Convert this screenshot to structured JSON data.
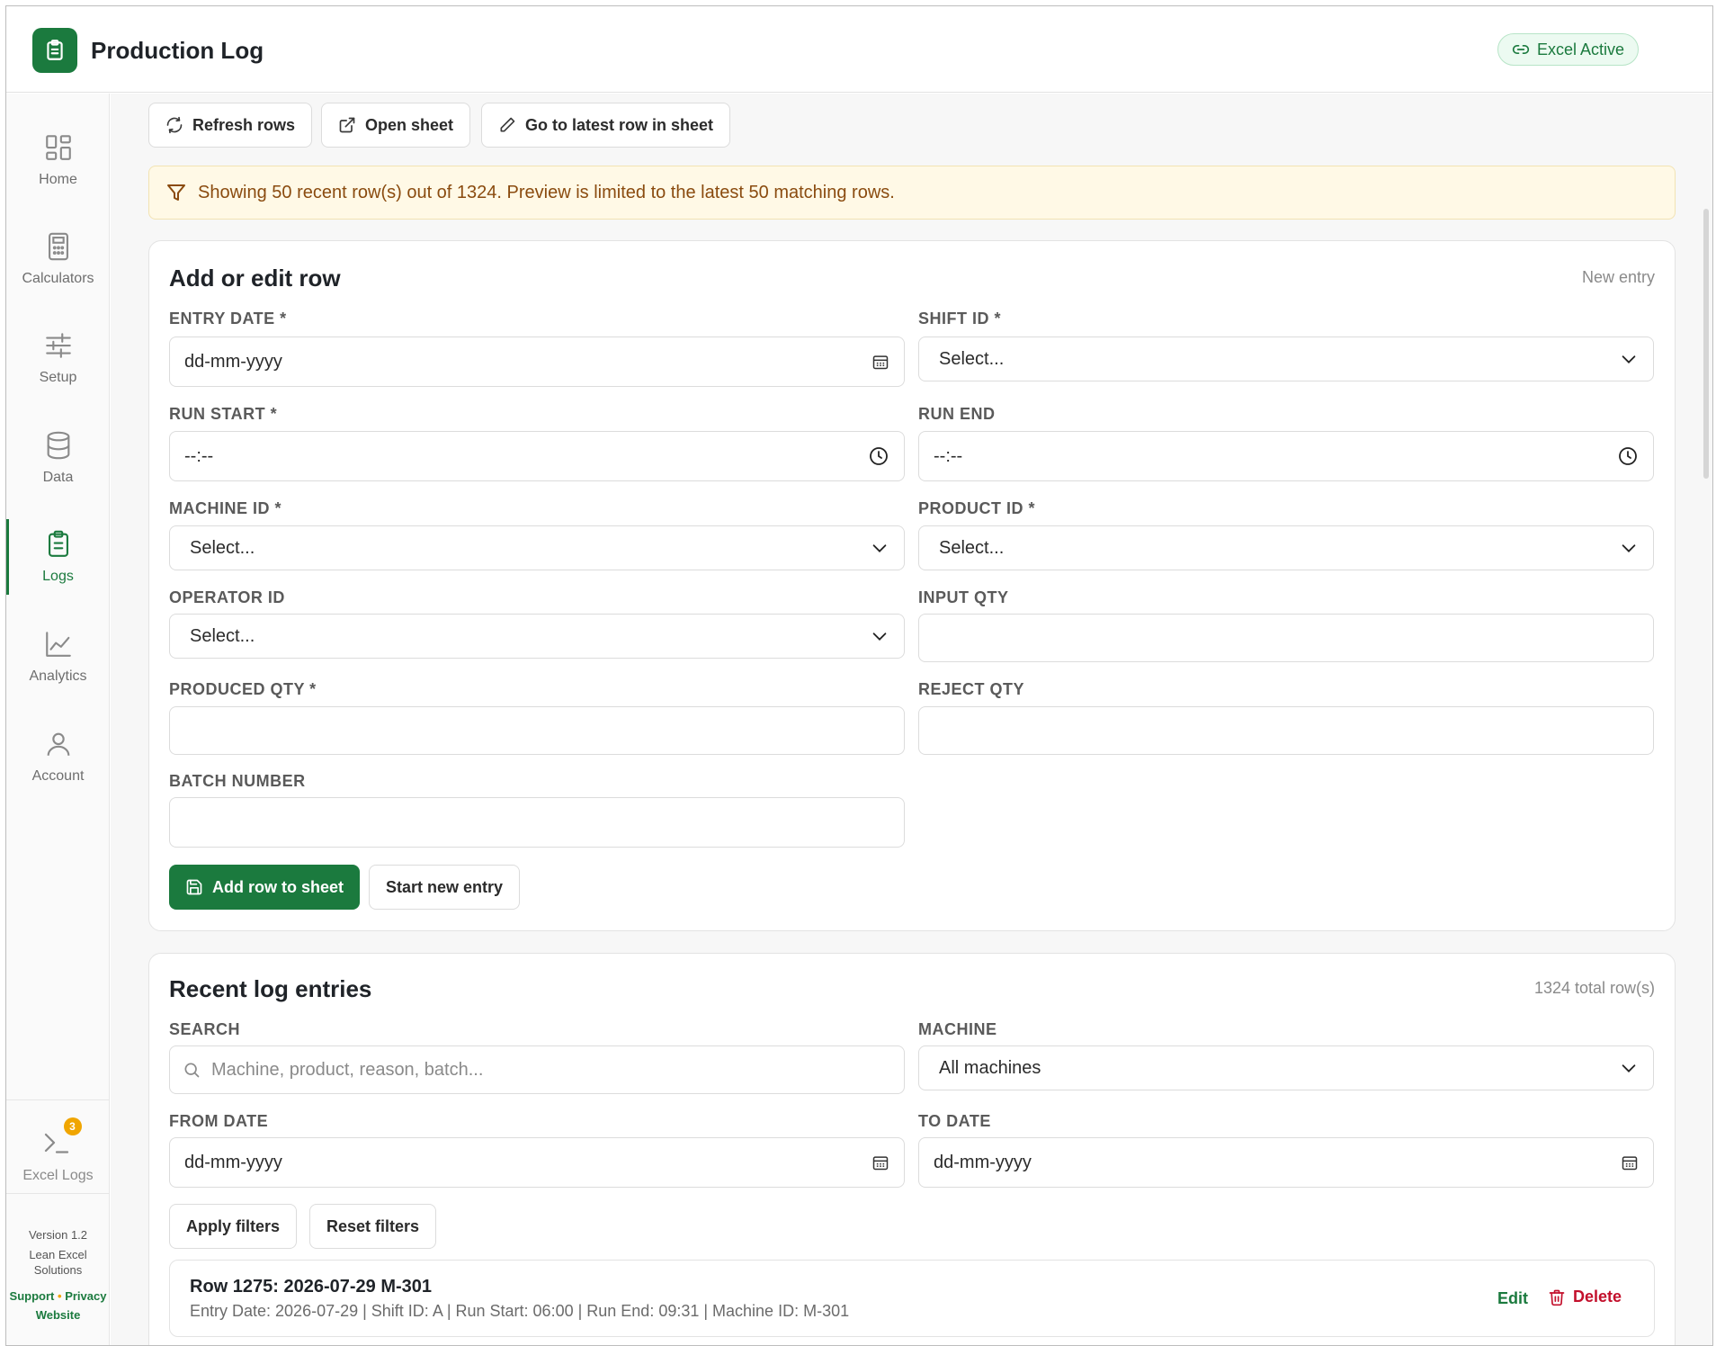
{
  "header": {
    "title": "Production Log",
    "status_badge": "Excel Active"
  },
  "sidebar": {
    "items": [
      {
        "label": "Home",
        "icon": "dashboard-icon"
      },
      {
        "label": "Calculators",
        "icon": "calculator-icon"
      },
      {
        "label": "Setup",
        "icon": "sliders-icon"
      },
      {
        "label": "Data",
        "icon": "database-icon"
      },
      {
        "label": "Logs",
        "icon": "clipboard-icon",
        "active": true
      },
      {
        "label": "Analytics",
        "icon": "chart-line-icon"
      },
      {
        "label": "Account",
        "icon": "user-icon"
      }
    ],
    "excel_logs": {
      "label": "Excel Logs",
      "count": "3"
    },
    "footer": {
      "version": "Version 1.2",
      "company": "Lean Excel Solutions",
      "support": "Support",
      "separator": "•",
      "privacy": "Privacy",
      "website": "Website"
    }
  },
  "toolbar": {
    "refresh": "Refresh rows",
    "open_sheet": "Open sheet",
    "go_latest": "Go to latest row in sheet"
  },
  "notice": "Showing 50 recent row(s) out of 1324. Preview is limited to the latest 50 matching rows.",
  "form": {
    "title": "Add or edit row",
    "mode": "New entry",
    "entry_date": {
      "label": "ENTRY DATE *",
      "value": "dd-mm-yyyy"
    },
    "shift_id": {
      "label": "SHIFT ID *",
      "value": "Select..."
    },
    "run_start": {
      "label": "RUN START *",
      "value": "--:--"
    },
    "run_end": {
      "label": "RUN END",
      "value": "--:--"
    },
    "machine_id": {
      "label": "MACHINE ID *",
      "value": "Select..."
    },
    "product_id": {
      "label": "PRODUCT ID *",
      "value": "Select..."
    },
    "operator_id": {
      "label": "OPERATOR ID",
      "value": "Select..."
    },
    "input_qty": {
      "label": "INPUT QTY",
      "value": ""
    },
    "produced_qty": {
      "label": "PRODUCED QTY *",
      "value": ""
    },
    "reject_qty": {
      "label": "REJECT QTY",
      "value": ""
    },
    "batch_number": {
      "label": "BATCH NUMBER",
      "value": ""
    },
    "add_button": "Add row to sheet",
    "new_entry_button": "Start new entry"
  },
  "recent": {
    "title": "Recent log entries",
    "total": "1324 total row(s)",
    "search": {
      "label": "SEARCH",
      "placeholder": "Machine, product, reason, batch..."
    },
    "machine": {
      "label": "MACHINE",
      "value": "All machines"
    },
    "from_date": {
      "label": "FROM DATE",
      "value": "dd-mm-yyyy"
    },
    "to_date": {
      "label": "TO DATE",
      "value": "dd-mm-yyyy"
    },
    "apply": "Apply filters",
    "reset": "Reset filters",
    "rows": [
      {
        "title": "Row 1275: 2026-07-29 M-301",
        "details": "Entry Date: 2026-07-29 | Shift ID: A | Run Start: 06:00 | Run End: 09:31 | Machine ID: M-301",
        "edit": "Edit",
        "delete": "Delete"
      }
    ]
  },
  "colors": {
    "brand": "#1b7a3e",
    "notice_bg": "#fff9e6",
    "notice_text": "#8a4b0f",
    "danger": "#c3102c",
    "badge": "#f0a500"
  }
}
